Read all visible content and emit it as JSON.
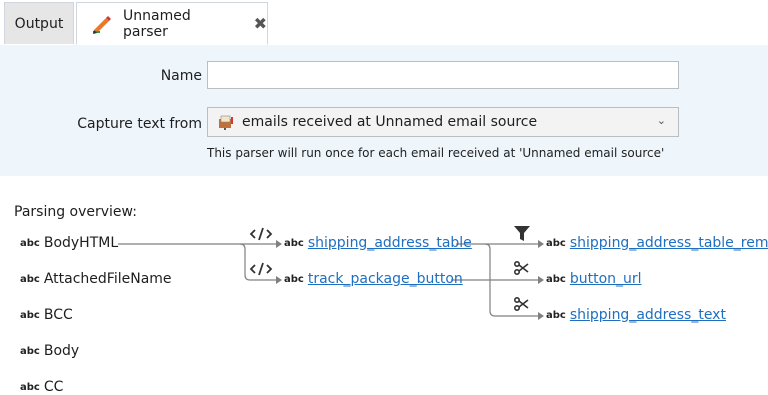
{
  "tabs": {
    "output_label": "Output",
    "active_label": "Unnamed parser",
    "active_icon": "pen-icon",
    "close_icon": "close-icon"
  },
  "config": {
    "name_label": "Name",
    "name_value": "",
    "capture_label": "Capture text from",
    "capture_value": "emails received at Unnamed email source",
    "capture_icon": "mailbox-icon",
    "hint": "This parser will run once for each email received at 'Unnamed email source'"
  },
  "overview": {
    "title": "Parsing overview:",
    "type_badge": "abc",
    "source_fields": [
      "BodyHTML",
      "AttachedFileName",
      "BCC",
      "Body",
      "CC"
    ],
    "step1": [
      {
        "label": "shipping_address_table",
        "operation_icon": "html-code-icon"
      },
      {
        "label": "track_package_button",
        "operation_icon": "html-code-icon"
      }
    ],
    "step2": [
      {
        "label": "shipping_address_table_rem...",
        "operation_icon": "filter-icon"
      },
      {
        "label": "button_url",
        "operation_icon": "scissors-icon"
      },
      {
        "label": "shipping_address_text",
        "operation_icon": "scissors-icon"
      }
    ]
  },
  "colors": {
    "config_background": "#eef6fc",
    "link": "#1f6fbf",
    "line": "#808080"
  }
}
